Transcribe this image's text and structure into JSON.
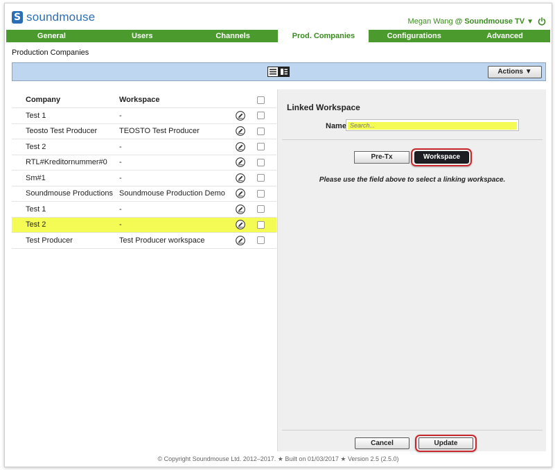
{
  "header": {
    "logo_text": "soundmouse",
    "user_name": "Megan Wang",
    "user_at": "@",
    "user_org": "Soundmouse TV",
    "caret": "▼"
  },
  "nav": {
    "tabs": [
      {
        "label": "General"
      },
      {
        "label": "Users"
      },
      {
        "label": "Channels"
      },
      {
        "label": "Prod. Companies",
        "active": true
      },
      {
        "label": "Configurations"
      },
      {
        "label": "Advanced"
      }
    ]
  },
  "breadcrumb": "Production Companies",
  "toolbar": {
    "actions_label": "Actions ▼"
  },
  "table": {
    "columns": {
      "company": "Company",
      "workspace": "Workspace"
    },
    "rows": [
      {
        "company": "Test 1",
        "workspace": "-"
      },
      {
        "company": "Teosto Test Producer",
        "workspace": "TEOSTO Test Producer"
      },
      {
        "company": "Test 2",
        "workspace": "-"
      },
      {
        "company": "RTL#Kreditornummer#0",
        "workspace": "-"
      },
      {
        "company": "Sm#1",
        "workspace": "-"
      },
      {
        "company": "Soundmouse Productions",
        "workspace": "Soundmouse Production Demo"
      },
      {
        "company": "Test 1",
        "workspace": "-"
      },
      {
        "company": "Test 2",
        "workspace": "-",
        "highlighted": true
      },
      {
        "company": "Test Producer",
        "workspace": "Test Producer workspace"
      }
    ]
  },
  "linked": {
    "title": "Linked Workspace",
    "name_label": "Name:",
    "search_placeholder": "Search...",
    "pretx_label": "Pre-Tx",
    "workspace_label": "Workspace",
    "hint": "Please use the field above to select a linking workspace.",
    "cancel_label": "Cancel",
    "update_label": "Update"
  },
  "footer": "© Copyright Soundmouse Ltd. 2012–2017. ★ Built on 01/03/2017 ★ Version 2.5 (2.5.0)",
  "colors": {
    "brand_blue": "#2a6fb6",
    "nav_green": "#4a9a2d",
    "highlight_yellow": "#f4fb55",
    "toolbar_blue": "#bed6ef",
    "annotation_red": "#c8262c"
  },
  "icons": [
    "power-icon",
    "list-view-icon",
    "split-view-icon",
    "edit-pencil-icon"
  ]
}
